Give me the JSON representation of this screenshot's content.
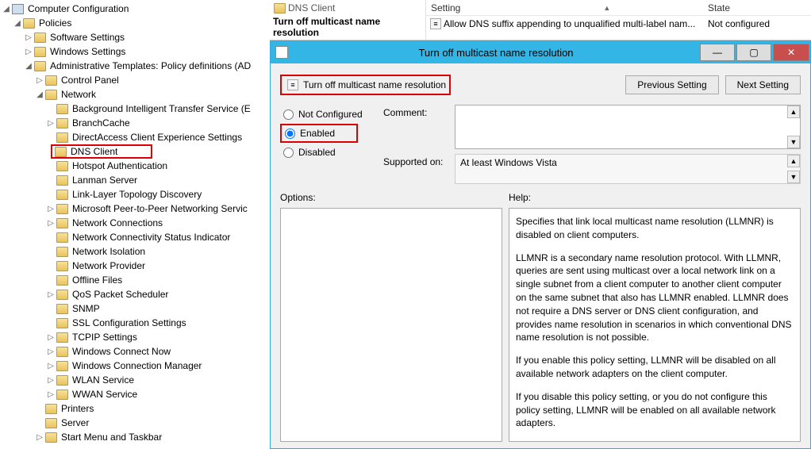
{
  "tree": {
    "root": "Computer Configuration",
    "policies": "Policies",
    "software": "Software Settings",
    "windows": "Windows Settings",
    "admin": "Administrative Templates: Policy definitions (AD",
    "ctrl": "Control Panel",
    "network": "Network",
    "items": [
      "Background Intelligent Transfer Service (E",
      "BranchCache",
      "DirectAccess Client Experience Settings",
      "DNS Client",
      "Hotspot Authentication",
      "Lanman Server",
      "Link-Layer Topology Discovery",
      "Microsoft Peer-to-Peer Networking Servic",
      "Network Connections",
      "Network Connectivity Status Indicator",
      "Network Isolation",
      "Network Provider",
      "Offline Files",
      "QoS Packet Scheduler",
      "SNMP",
      "SSL Configuration Settings",
      "TCPIP Settings",
      "Windows Connect Now",
      "Windows Connection Manager",
      "WLAN Service",
      "WWAN Service"
    ],
    "printers": "Printers",
    "server": "Server",
    "startmenu": "Start Menu and Taskbar"
  },
  "top": {
    "crumb": "DNS Client",
    "bold": "Turn off multicast name resolution",
    "col_setting": "Setting",
    "col_state": "State",
    "row_setting": "Allow DNS suffix appending to unqualified multi-label nam...",
    "row_state": "Not configured"
  },
  "dialog": {
    "title": "Turn off multicast name resolution",
    "setting_name": "Turn off multicast name resolution",
    "prev": "Previous Setting",
    "next": "Next Setting",
    "r_notconf": "Not Configured",
    "r_enabled": "Enabled",
    "r_disabled": "Disabled",
    "comment_label": "Comment:",
    "supported_label": "Supported on:",
    "supported_value": "At least Windows Vista",
    "options_label": "Options:",
    "help_label": "Help:",
    "help_p1": "Specifies that link local multicast name resolution (LLMNR) is disabled on client computers.",
    "help_p2": "LLMNR is a secondary name resolution protocol. With LLMNR, queries are sent using multicast over a local network link on a single subnet from a client computer to another client computer on the same subnet that also has LLMNR enabled. LLMNR does not require a DNS server or DNS client configuration, and provides name resolution in scenarios in which conventional DNS name resolution is not possible.",
    "help_p3": "If you enable this policy setting, LLMNR will be disabled on all available network adapters on the client computer.",
    "help_p4": "If you disable this policy setting, or you do not configure this policy setting, LLMNR will be enabled on all available network adapters."
  }
}
